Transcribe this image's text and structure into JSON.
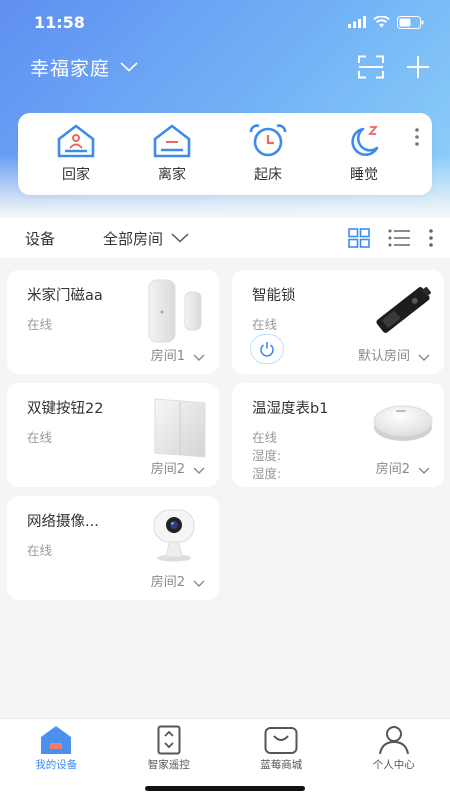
{
  "status_bar": {
    "time": "11:58"
  },
  "header": {
    "home_name": "幸福家庭"
  },
  "scenes": [
    {
      "label": "回家",
      "icon": "home-arrive-icon"
    },
    {
      "label": "离家",
      "icon": "home-leave-icon"
    },
    {
      "label": "起床",
      "icon": "alarm-clock-icon"
    },
    {
      "label": "睡觉",
      "icon": "moon-sleep-icon"
    }
  ],
  "toolbar": {
    "devices_label": "设备",
    "room_filter": "全部房间"
  },
  "devices": [
    {
      "name": "米家门磁aa",
      "status": "在线",
      "room": "房间1"
    },
    {
      "name": "智能锁",
      "status": "在线",
      "room": "默认房间"
    },
    {
      "name": "双键按钮22",
      "status": "在线",
      "room": "房间2"
    },
    {
      "name": "温湿度表b1",
      "status": "在线",
      "room": "房间2",
      "humidity_label": "湿度:",
      "temperature_label": "湿度:"
    },
    {
      "name": "网络摄像...",
      "status": "在线",
      "room": "房间2"
    }
  ],
  "tabs": [
    {
      "label": "我的设备",
      "icon": "home-icon",
      "active": true
    },
    {
      "label": "智家遥控",
      "icon": "remote-icon",
      "active": false
    },
    {
      "label": "蓝莓商城",
      "icon": "shopping-bag-icon",
      "active": false
    },
    {
      "label": "个人中心",
      "icon": "person-icon",
      "active": false
    }
  ],
  "colors": {
    "accent": "#3b8bf0",
    "hero_start": "#5f8ff2",
    "hero_end": "#8fd3f9"
  }
}
